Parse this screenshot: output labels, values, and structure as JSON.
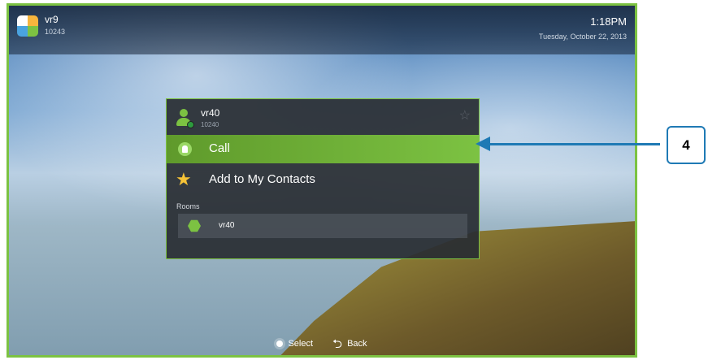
{
  "header": {
    "user_name": "vr9",
    "user_extension": "10243",
    "time": "1:18PM",
    "date": "Tuesday, October 22, 2013"
  },
  "popup": {
    "contact_name": "vr40",
    "contact_extension": "10240",
    "favorite_icon": "star-outline-icon",
    "actions": [
      {
        "label": "Call",
        "icon": "call-icon",
        "selected": true
      },
      {
        "label": "Add to My Contacts",
        "icon": "star-icon",
        "selected": false
      }
    ],
    "rooms_header": "Rooms",
    "rooms": [
      {
        "label": "vr40",
        "icon": "room-hexagon-icon"
      }
    ]
  },
  "hints": {
    "select_label": "Select",
    "back_label": "Back"
  },
  "callout": {
    "number": "4",
    "color": "#1f7ab5"
  },
  "colors": {
    "accent": "#7cc242",
    "star": "#f6c337"
  }
}
